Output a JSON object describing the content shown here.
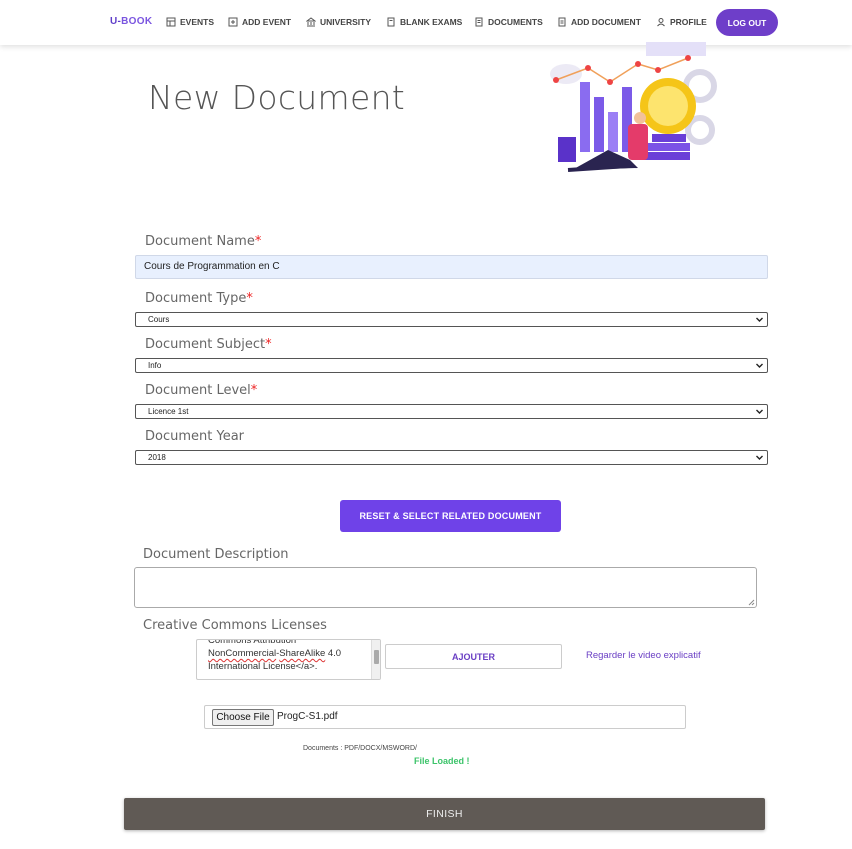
{
  "nav": {
    "brand_part1": "U-",
    "brand_part2": "BOOK",
    "items": [
      {
        "label": "EVENTS",
        "icon": "events-icon"
      },
      {
        "label": "ADD EVENT",
        "icon": "add-event-icon"
      },
      {
        "label": "UNIVERSITY",
        "icon": "university-icon"
      },
      {
        "label": "BLANK EXAMS",
        "icon": "blank-exams-icon"
      },
      {
        "label": "DOCUMENTS",
        "icon": "documents-icon"
      },
      {
        "label": "ADD DOCUMENT",
        "icon": "add-document-icon"
      },
      {
        "label": "PROFILE",
        "icon": "profile-icon"
      }
    ],
    "logout_label": "LOG OUT"
  },
  "page": {
    "title": "New Document"
  },
  "form": {
    "name_label": "Document Name",
    "name_value": "Cours de Programmation en C",
    "type_label": "Document Type",
    "type_value": "Cours",
    "subject_label": "Document Subject",
    "subject_value": "Info",
    "level_label": "Document Level",
    "level_value": "Licence 1st",
    "year_label": "Document Year",
    "year_value": "2018",
    "required_mark": "*",
    "reset_button": "RESET & SELECT RELATED DOCUMENT",
    "description_label": "Document Description",
    "description_value": "",
    "licenses_label": "Creative Commons Licenses",
    "license_line1": "Commons Attribution",
    "license_line2_a": "NonCommercial",
    "license_line2_b": "-",
    "license_line2_c": "ShareAlike",
    "license_line2_d": " 4.0",
    "license_line3": "International License</a>.",
    "add_button": "AJOUTER",
    "video_link": "Regarder le video explicatif",
    "choose_file": "Choose File",
    "file_name": "ProgC-S1.pdf",
    "formats_hint": "Documents : PDF/DOCX/MSWORD/",
    "file_status": "File Loaded !",
    "finish_button": "FINISH"
  },
  "colors": {
    "accent": "#6f42e8",
    "logout": "#6e3ec9",
    "finish": "#605a55",
    "success": "#3cc46a",
    "required": "#ee2222"
  }
}
